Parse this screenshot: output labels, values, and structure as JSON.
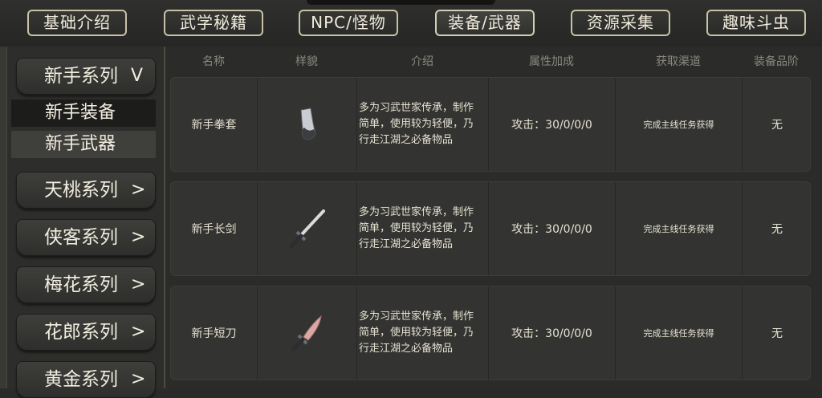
{
  "tabs": [
    {
      "label": "基础介绍"
    },
    {
      "label": "武学秘籍"
    },
    {
      "label": "NPC/怪物"
    },
    {
      "label": "装备/武器"
    },
    {
      "label": "资源采集"
    },
    {
      "label": "趣味斗虫"
    }
  ],
  "sidebar": {
    "expanded_series": {
      "label": "新手系列",
      "chevron": "V"
    },
    "subitems": [
      {
        "label": "新手装备"
      },
      {
        "label": "新手武器"
      }
    ],
    "series": [
      {
        "label": "天桃系列",
        "chevron": ">"
      },
      {
        "label": "侠客系列",
        "chevron": ">"
      },
      {
        "label": "梅花系列",
        "chevron": ">"
      },
      {
        "label": "花郎系列",
        "chevron": ">"
      },
      {
        "label": "黄金系列",
        "chevron": ">"
      }
    ]
  },
  "table": {
    "headers": [
      "名称",
      "样貌",
      "介绍",
      "属性加成",
      "获取渠道",
      "装备品阶"
    ],
    "rows": [
      {
        "name": "新手拳套",
        "icon": "gauntlet-icon",
        "desc": "多为习武世家传承，制作简单，使用较为轻便，乃行走江湖之必备物品",
        "attr": "攻击：30/0/0/0",
        "source": "完成主线任务获得",
        "grade": "无"
      },
      {
        "name": "新手长剑",
        "icon": "sword-icon",
        "desc": "多为习武世家传承，制作简单，使用较为轻便，乃行走江湖之必备物品",
        "attr": "攻击：30/0/0/0",
        "source": "完成主线任务获得",
        "grade": "无"
      },
      {
        "name": "新手短刀",
        "icon": "dagger-icon",
        "desc": "多为习武世家传承，制作简单，使用较为轻便，乃行走江湖之必备物品",
        "attr": "攻击：30/0/0/0",
        "source": "完成主线任务获得",
        "grade": "无"
      }
    ]
  }
}
